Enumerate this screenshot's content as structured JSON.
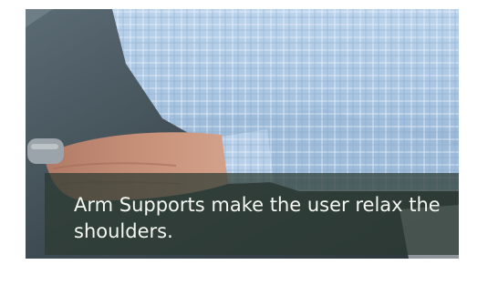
{
  "image": {
    "caption": "Arm Supports make the user relax the shoulders."
  },
  "colors": {
    "shirt": "#a9c6e4",
    "skin": "#c58f77",
    "table": "#3e4b52",
    "caption_text": "#f4f7f2",
    "caption_band": "#2c3a32"
  }
}
